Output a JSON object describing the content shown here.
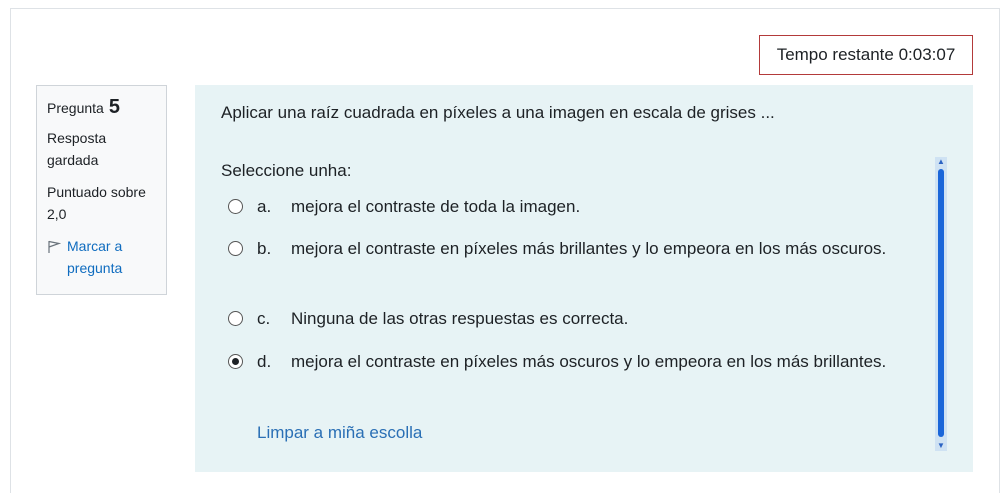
{
  "timer": {
    "label": "Tempo restante 0:03:07"
  },
  "info": {
    "question_label": "Pregunta",
    "question_number": "5",
    "state": "Resposta gardada",
    "grade": "Puntuado sobre 2,0",
    "flag_label": "Marcar a pregunta"
  },
  "question": {
    "text": "Aplicar una raíz cuadrada en píxeles a una imagen en escala de grises ...",
    "prompt": "Seleccione unha:",
    "answers": [
      {
        "letter": "a.",
        "text": "mejora el contraste de toda la imagen.",
        "selected": false
      },
      {
        "letter": "b.",
        "text": "mejora el contraste en píxeles más brillantes y lo empeora en los más oscuros.",
        "selected": false
      },
      {
        "letter": "c.",
        "text": "Ninguna de las otras respuestas es correcta.",
        "selected": false
      },
      {
        "letter": "d.",
        "text": "mejora el contraste en píxeles más oscuros y lo empeora en los más brillantes.",
        "selected": true
      }
    ],
    "clear_label": "Limpar a miña escolla"
  }
}
